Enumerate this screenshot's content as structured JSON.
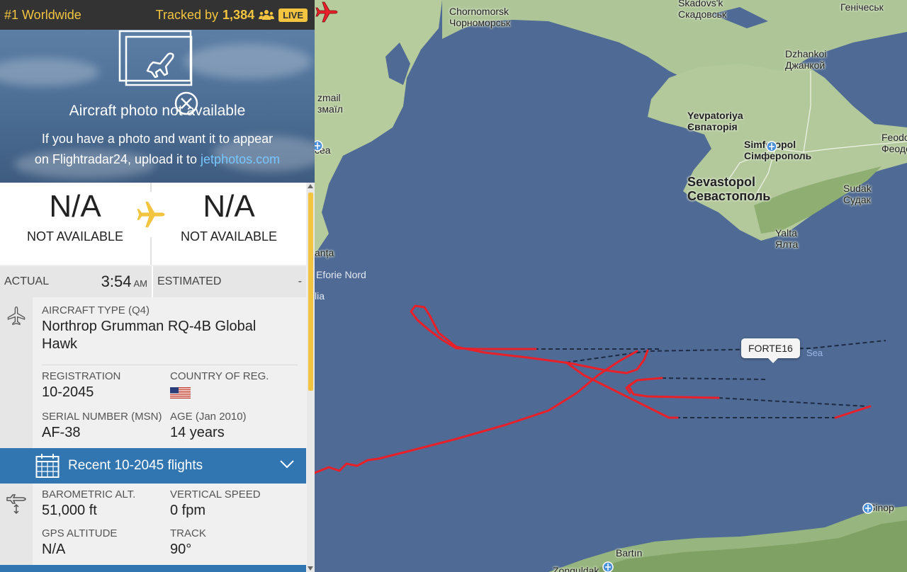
{
  "topbar": {
    "rank": "#1 Worldwide",
    "tracked_prefix": "Tracked by",
    "tracked_count": "1,384",
    "live": "LIVE"
  },
  "photo": {
    "title": "Aircraft photo not available",
    "line1": "If you have a photo and want it to appear",
    "line2_prefix": "on Flightradar24, upload it to",
    "link": "jetphotos.com"
  },
  "route": {
    "from_code": "N/A",
    "from_name": "NOT AVAILABLE",
    "to_code": "N/A",
    "to_name": "NOT AVAILABLE"
  },
  "times": {
    "actual_label": "ACTUAL",
    "actual_time": "3:54",
    "actual_ampm": "AM",
    "estimated_label": "ESTIMATED",
    "estimated_value": "-"
  },
  "aircraft": {
    "type_label": "AIRCRAFT TYPE (Q4)",
    "type_value_line1": "Northrop Grumman RQ-4B Global",
    "type_value_line2": "Hawk",
    "registration_label": "REGISTRATION",
    "registration_value": "10-2045",
    "country_label": "COUNTRY OF REG.",
    "serial_label": "SERIAL NUMBER (MSN)",
    "serial_value": "AF-38",
    "age_label": "AGE (Jan 2010)",
    "age_value": "14 years"
  },
  "recent": {
    "label": "Recent 10-2045 flights"
  },
  "altitude": {
    "baro_label": "BAROMETRIC ALT.",
    "baro_value": "51,000 ft",
    "vspeed_label": "VERTICAL SPEED",
    "vspeed_value": "0 fpm",
    "gps_label": "GPS ALTITUDE",
    "gps_value": "N/A",
    "track_label": "TRACK",
    "track_value": "90°"
  },
  "map": {
    "callsign": "FORTE16",
    "sea_label": "Sea",
    "cities": {
      "chornomorsk_en": "Chornomorsk",
      "chornomorsk_uk": "Чорноморськ",
      "skadovsk_en": "Skadovs'k",
      "skadovsk_uk": "Скадовськ",
      "henichesk_uk": "Генічеськ",
      "dzhankoi_en": "Dzhankoi",
      "dzhankoi_uk": "Джанкой",
      "izmail_en": "zmail",
      "izmail_uk": "змаїл",
      "tulcea": "cea",
      "yevpatoriya_en": "Yevpatoriya",
      "yevpatoriya_uk": "Євпаторія",
      "simferopol_en": "Simferopol",
      "simferopol_uk": "Сімферополь",
      "feodosia_en": "Feodos",
      "feodosia_uk": "Феодос",
      "sevastopol_en": "Sevastopol",
      "sevastopol_uk": "Севастополь",
      "sudak_en": "Sudak",
      "sudak_uk": "Судак",
      "yalta_en": "Yalta",
      "yalta_uk": "Ялта",
      "constanta": "anța",
      "eforie": "Eforie Nord",
      "mangalia": "lia",
      "bartin": "Bartın",
      "sinop": "Sinop",
      "zonguldak": "Zonguldak"
    }
  },
  "colors": {
    "accent": "#f3c43f",
    "blue_bar": "#3276b1",
    "track": "#e8202a",
    "sea": "#4f6a94",
    "land": "#a9c28e"
  }
}
